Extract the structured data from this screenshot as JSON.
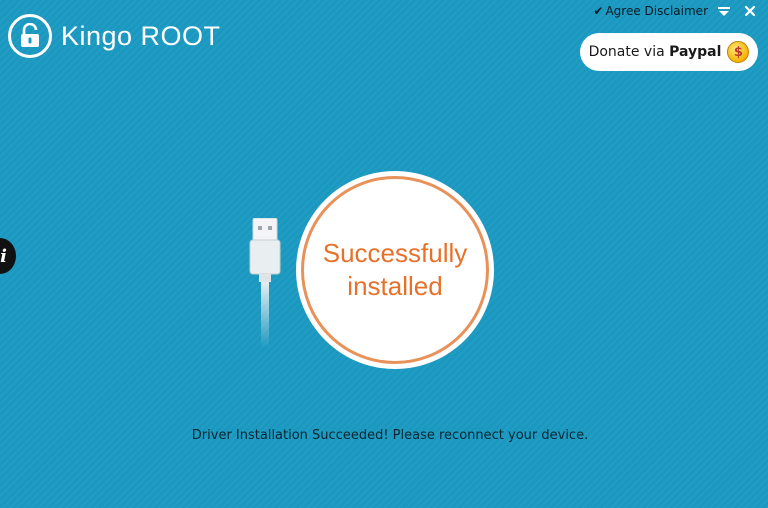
{
  "app": {
    "title": "Kingo ROOT"
  },
  "top_controls": {
    "disclaimer_label": "Agree Disclaimer",
    "check_icon": "check-icon",
    "menu_icon": "menu-icon",
    "close_icon": "close-icon"
  },
  "donate": {
    "prefix": "Donate via ",
    "brand": "Paypal",
    "coin_symbol": "$"
  },
  "info_button": {
    "symbol": "i"
  },
  "status": {
    "text": "Successfully installed",
    "accent_color": "#e8712a"
  },
  "message": "Driver Installation Succeeded! Please reconnect your device.",
  "colors": {
    "background": "#1a98c0",
    "text_dark": "#0c2530"
  }
}
